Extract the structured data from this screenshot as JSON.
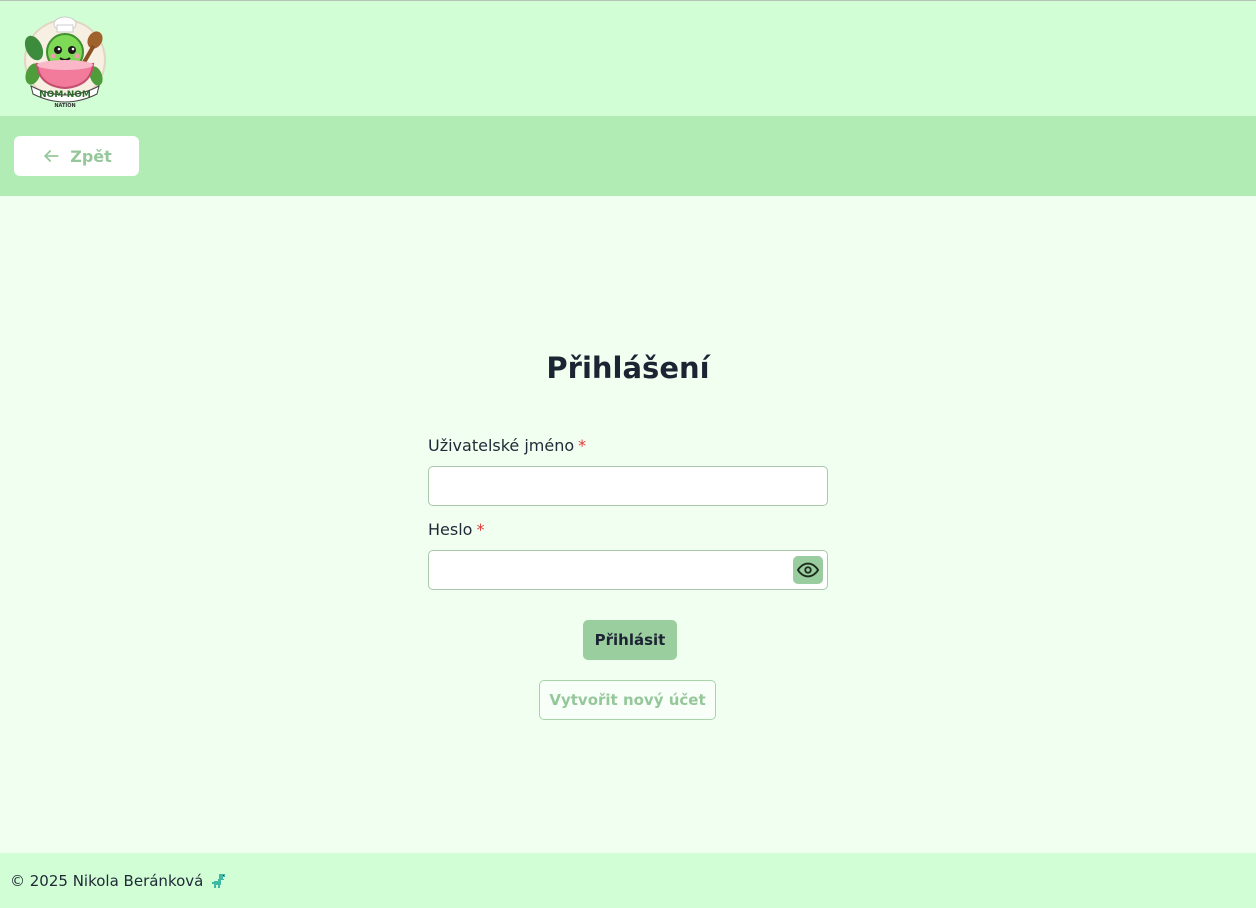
{
  "header": {
    "logo_text_main": "NOM·NOM",
    "logo_text_sub": "NATION"
  },
  "toolbar": {
    "back_label": "Zpět"
  },
  "login": {
    "title": "Přihlášení",
    "username_label": "Uživatelské jméno",
    "password_label": "Heslo",
    "required_mark": "*",
    "username_value": "",
    "password_value": "",
    "submit_label": "Přihlásit",
    "register_label": "Vytvořit nový účet"
  },
  "footer": {
    "copyright": "© 2025 Nikola Beránková"
  },
  "colors": {
    "header_bg": "#d1fed5",
    "subbar_bg": "#b0ecb3",
    "main_bg": "#f0fff0",
    "accent": "#9bce9f",
    "required": "#e53935"
  },
  "icons": {
    "back": "arrow-left-icon",
    "password_toggle": "eye-icon",
    "footer": "dinosaur-icon",
    "logo": "nom-nom-nation-logo"
  }
}
